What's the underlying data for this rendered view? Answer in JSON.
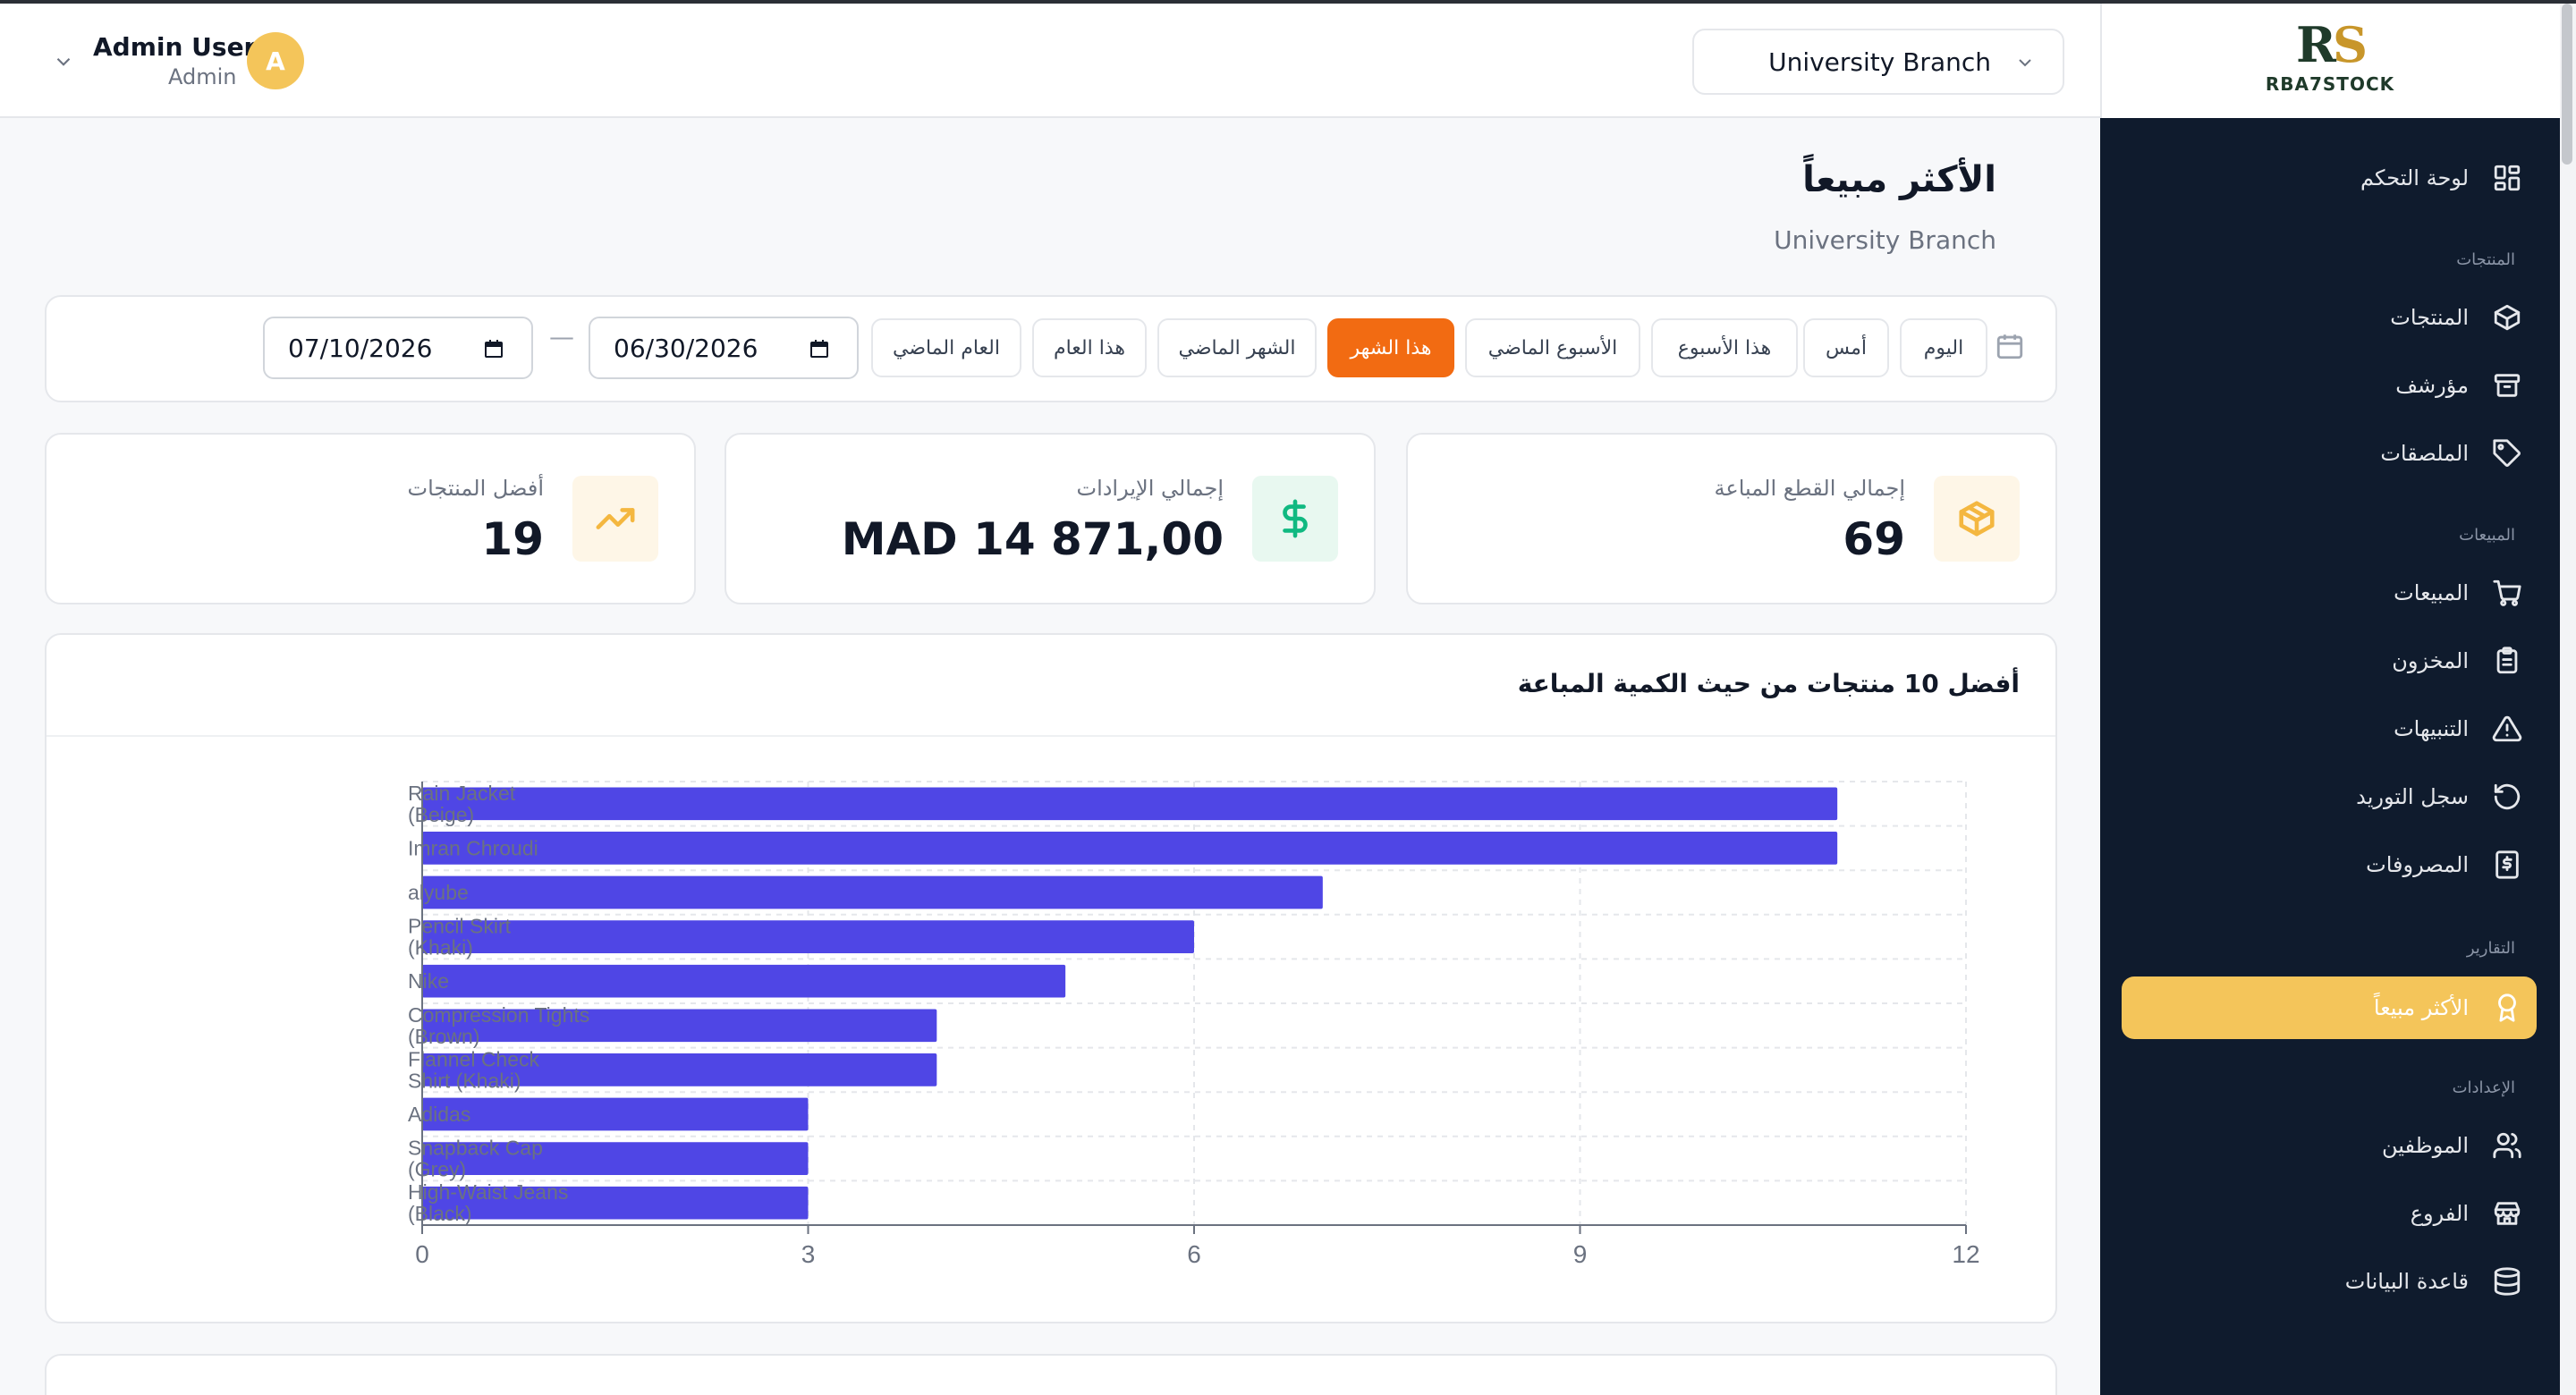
{
  "header": {
    "user_name": "Admin User",
    "user_role": "Admin",
    "avatar_initial": "A",
    "branch": "University Branch"
  },
  "brand": {
    "logo_letters": "RS",
    "logo_text": "RBA7STOCK"
  },
  "sidebar": {
    "dashboard": "لوحة التحكم",
    "section_products": "المنتجات",
    "products": "المنتجات",
    "archive": "مؤرشف",
    "tags": "الملصقات",
    "section_sales": "المبيعات",
    "sales": "المبيعات",
    "inventory": "المخزون",
    "alerts": "التنبيهات",
    "supply_log": "سجل التوريد",
    "expenses": "المصروفات",
    "section_reports": "التقارير",
    "best_sellers": "الأكثر مبيعاً",
    "section_settings": "الإعدادات",
    "employees": "الموظفين",
    "branches": "الفروع",
    "database": "قاعدة البيانات"
  },
  "page": {
    "title": "الأكثر مبيعاً",
    "subtitle": "University Branch"
  },
  "filters": {
    "today": "اليوم",
    "yesterday": "أمس",
    "this_week": "هذا الأسبوع",
    "last_week": "الأسبوع الماضي",
    "this_month": "هذا الشهر",
    "last_month": "الشهر الماضي",
    "this_year": "هذا العام",
    "last_year": "العام الماضي",
    "active": "this_month",
    "date_from": "06/30/2026",
    "date_to": "07/10/2026"
  },
  "stats": {
    "units_label": "إجمالي القطع المباعة",
    "units_value": "69",
    "revenue_label": "إجمالي الإيرادات",
    "revenue_value": "MAD 14 871,00",
    "top_label": "أفضل المنتجات",
    "top_value": "19"
  },
  "chart_title": "أفضل 10 منتجات من حيث الكمية المباعة",
  "chart_data": {
    "type": "bar",
    "orientation": "horizontal",
    "categories": [
      "Rain Jacket (Beige)",
      "Imran Chroudi",
      "alyube",
      "Pencil Skirt (Khaki)",
      "Nike",
      "Compression Tights (Brown)",
      "Flannel Check Shirt (Khaki)",
      "Adidas",
      "Snapback Cap (Grey)",
      "High-Waist Jeans (Black)"
    ],
    "values": [
      11,
      11,
      7,
      6,
      5,
      4,
      4,
      3,
      3,
      3
    ],
    "xlim": [
      0,
      12
    ],
    "xticks": [
      0,
      3,
      6,
      9,
      12
    ],
    "bar_color": "#4f46e5",
    "grid": true
  },
  "colors": {
    "accent": "#f26b12",
    "sidebar_bg": "#0f1b2d",
    "active_nav": "#f4c55a"
  }
}
